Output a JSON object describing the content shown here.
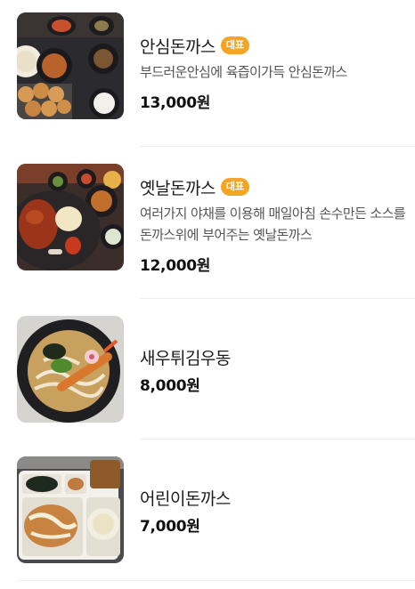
{
  "menu": [
    {
      "name": "안심돈까스",
      "badge": "대표",
      "description": "부드러운안심에 육즙이가득 안심돈까스",
      "price": "13,000원"
    },
    {
      "name": "옛날돈까스",
      "badge": "대표",
      "description": "여러가지 야채를 이용해 매일아침 손수만든 소스를 돈까스위에 부어주는 옛날돈까스",
      "price": "12,000원"
    },
    {
      "name": "새우튀김우동",
      "badge": "",
      "description": "",
      "price": "8,000원"
    },
    {
      "name": "어린이돈까스",
      "badge": "",
      "description": "",
      "price": "7,000원"
    }
  ],
  "colors": {
    "badge": "#f5a524",
    "price": "#111111",
    "description": "#555555",
    "divider": "#eeeeee"
  }
}
